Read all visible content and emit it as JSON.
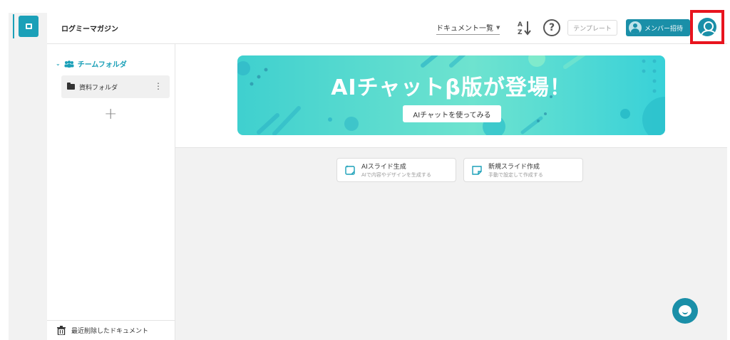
{
  "topbar": {
    "workspace_title": "ログミーマガジン",
    "doc_view_select": "ドキュメント一覧",
    "template_button": "テンプレート",
    "invite_button": "メンバー招待"
  },
  "sidebar": {
    "team_folder_label": "チームフォルダ",
    "folders": [
      {
        "label": "資料フォルダ"
      }
    ],
    "add_label": "+",
    "trash_label": "最近削除したドキュメント"
  },
  "banner": {
    "title": "AIチャットβ版が登場！",
    "button_label": "AIチャットを使ってみる"
  },
  "actions": [
    {
      "title": "AIスライド生成",
      "subtitle": "AIで内容やデザインを生成する"
    },
    {
      "title": "新規スライド作成",
      "subtitle": "手動で設定して作成する"
    }
  ],
  "colors": {
    "accent": "#1ba0b8",
    "button": "#1a8fa8",
    "highlight_border": "#e8141e",
    "banner_start": "#3fd0cf",
    "banner_end": "#38d1d8"
  }
}
